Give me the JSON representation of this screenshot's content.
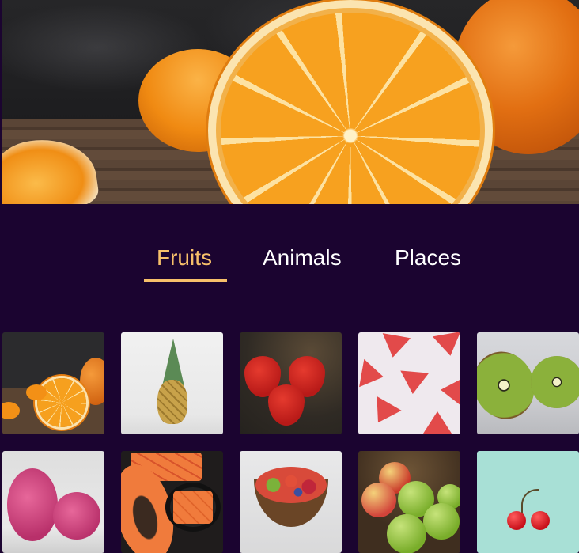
{
  "hero": {
    "image": "oranges-hero-image"
  },
  "tabs": [
    {
      "label": "Fruits",
      "active": true
    },
    {
      "label": "Animals",
      "active": false
    },
    {
      "label": "Places",
      "active": false
    }
  ],
  "gallery": {
    "items": [
      {
        "image": "oranges"
      },
      {
        "image": "pineapple"
      },
      {
        "image": "strawberries"
      },
      {
        "image": "watermelon-slices"
      },
      {
        "image": "kiwi"
      },
      {
        "image": "dragon-fruit"
      },
      {
        "image": "papaya"
      },
      {
        "image": "fruit-bowl"
      },
      {
        "image": "apples"
      },
      {
        "image": "cherries"
      }
    ]
  },
  "colors": {
    "background": "#1b0430",
    "accent": "#f7c06a",
    "tab_text": "#ffffff"
  }
}
